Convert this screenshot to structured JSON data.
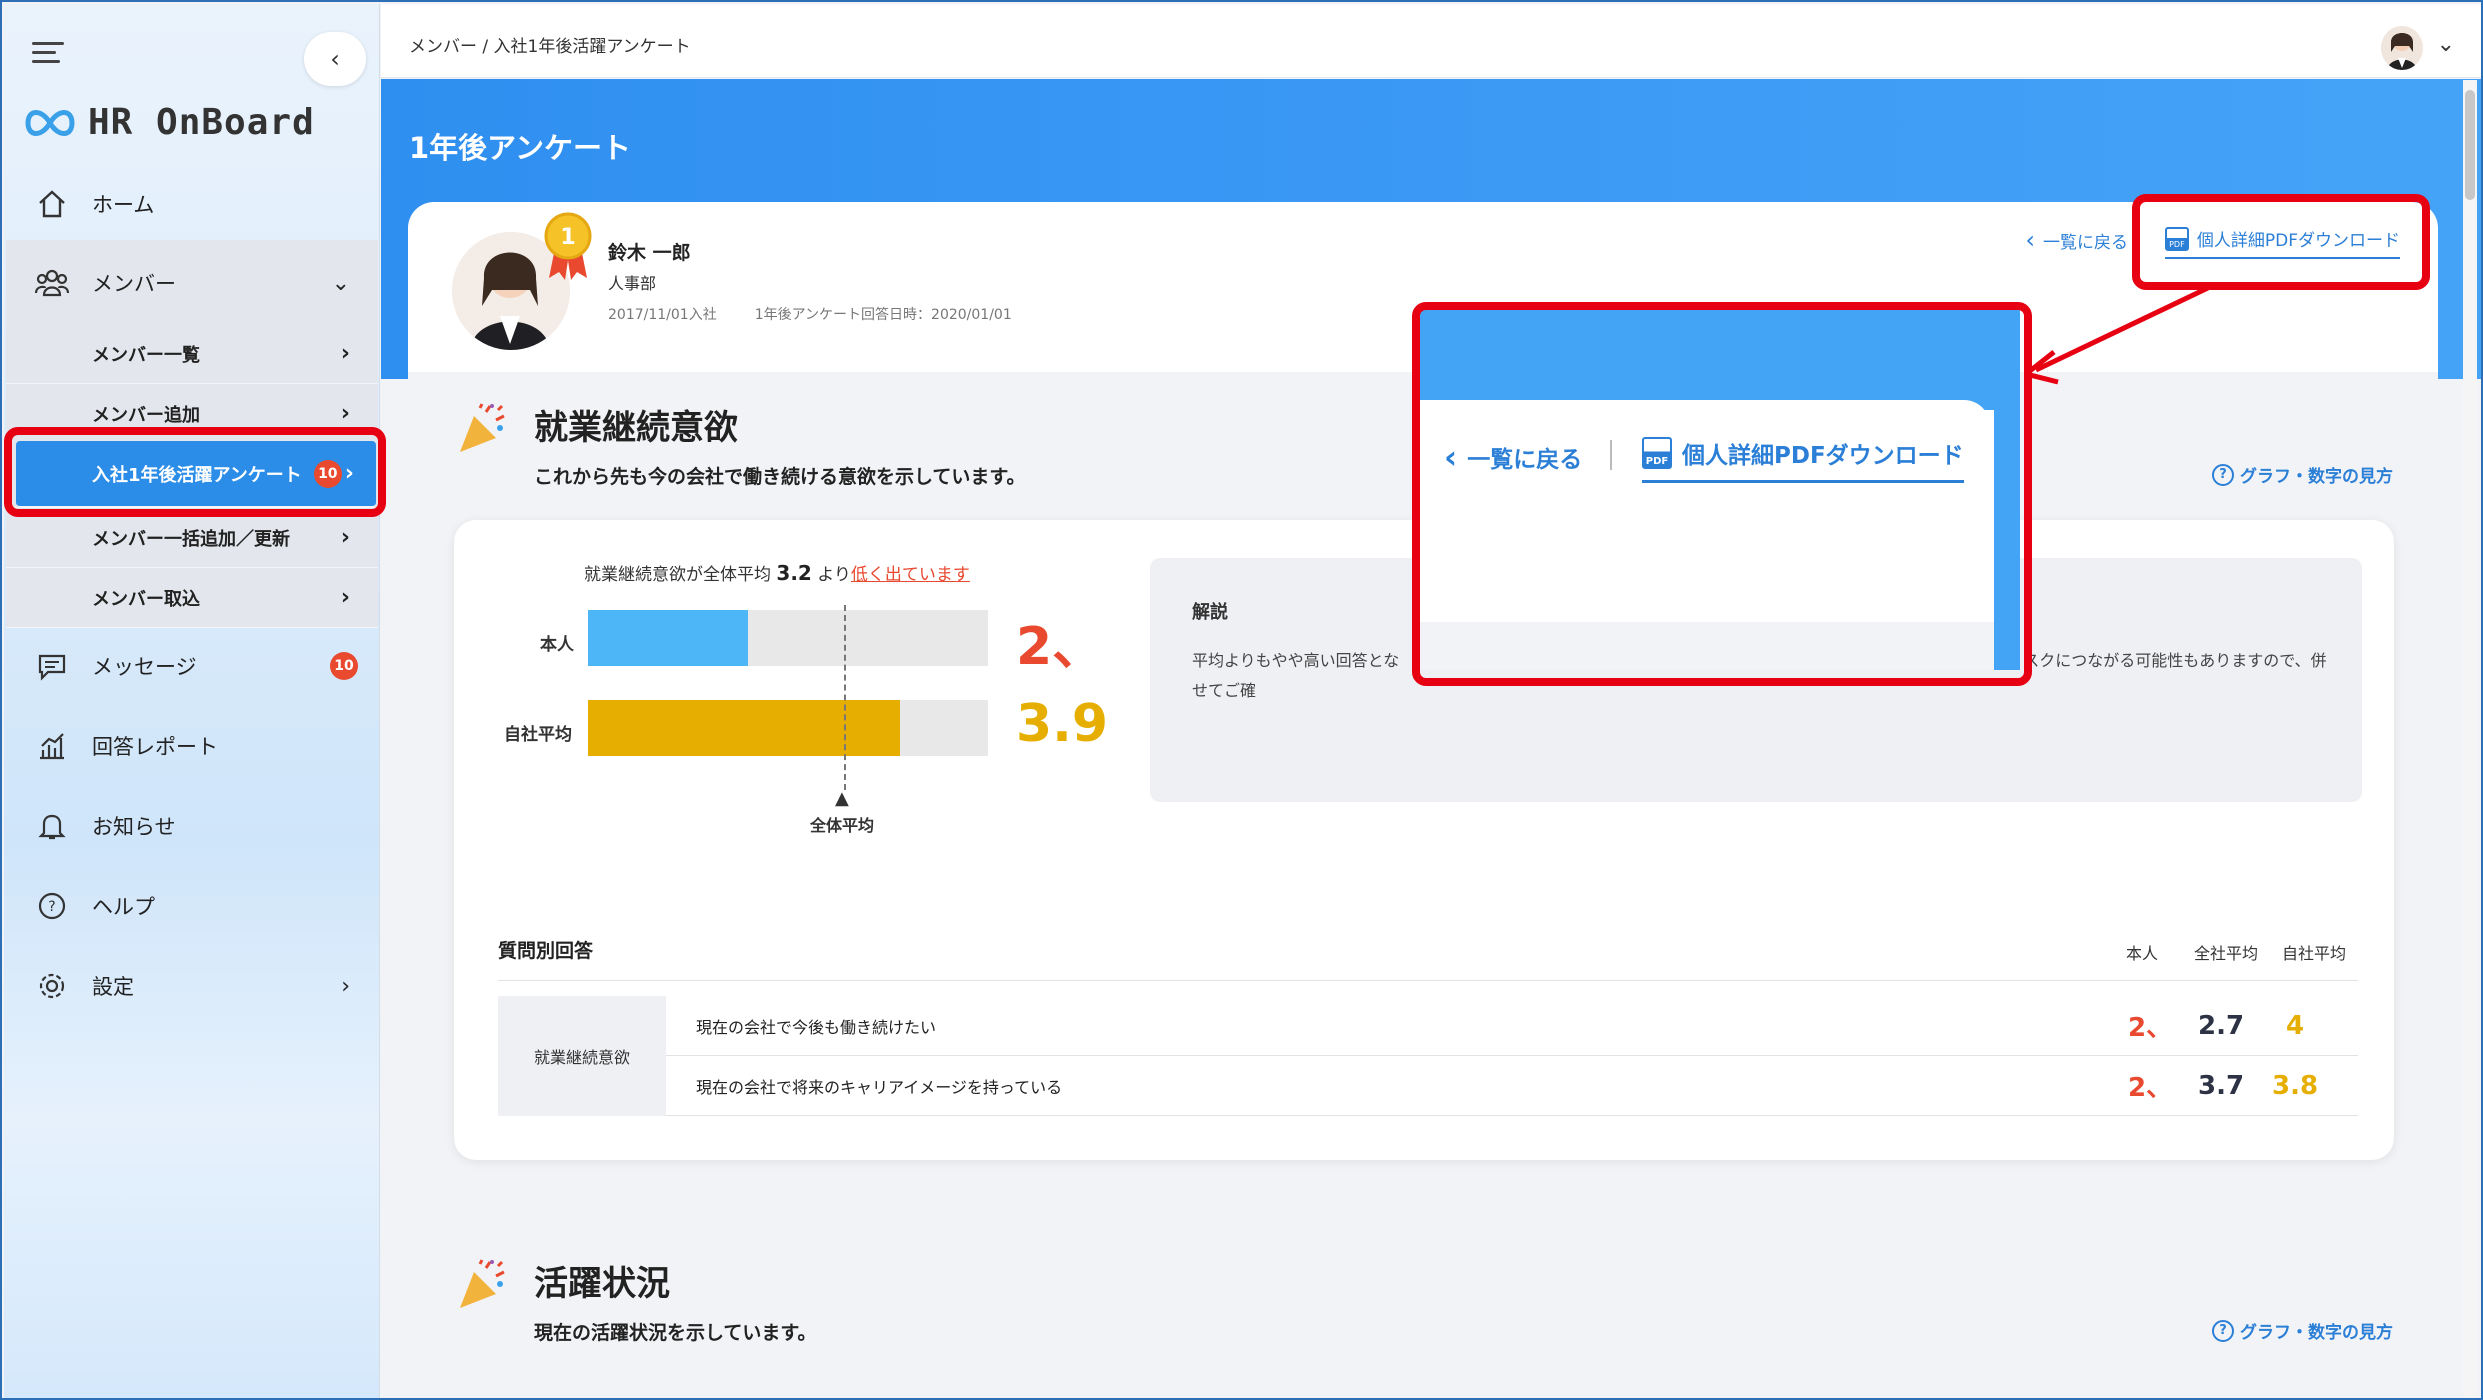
{
  "sidebar": {
    "logo": "HR OnBoard",
    "items": [
      {
        "label": "ホーム"
      },
      {
        "label": "メンバー"
      },
      {
        "label": "メッセージ",
        "badge": "10"
      },
      {
        "label": "回答レポート"
      },
      {
        "label": "お知らせ"
      },
      {
        "label": "ヘルプ"
      },
      {
        "label": "設定"
      }
    ],
    "subitems": [
      {
        "label": "メンバー一覧"
      },
      {
        "label": "メンバー追加"
      },
      {
        "label": "入社1年後活躍アンケート",
        "badge": "10"
      },
      {
        "label": "メンバー一括追加／更新"
      },
      {
        "label": "メンバー取込"
      }
    ]
  },
  "topbar": {
    "breadcrumb": "メンバー / 入社1年後活躍アンケート"
  },
  "hero": {
    "title": "1年後アンケート"
  },
  "profile": {
    "medal_rank": "1",
    "name": "鈴木 一郎",
    "dept": "人事部",
    "joined": "2017/11/01入社",
    "answered": "1年後アンケート回答日時：2020/01/01",
    "back_label": "一覧に戻る",
    "pdf_label": "個人詳細PDFダウンロード"
  },
  "section1": {
    "title": "就業継続意欲",
    "desc": "これから先も今の会社で働き続ける意欲を示しています。",
    "help": "グラフ・数字の見方",
    "compare_prefix": "就業継続意欲が全体平均",
    "compare_value": "3.2",
    "compare_mid": "より",
    "compare_result": "低く出ています",
    "rows": [
      {
        "label": "本人",
        "value": 2,
        "score_text": "2、",
        "color": "#4db6f7",
        "score_color": "#e8492f"
      },
      {
        "label": "自社平均",
        "value": 3.9,
        "score_text": "3.9",
        "color": "#e6ae00",
        "score_color": "#e6ae00"
      }
    ],
    "bar_max": 5,
    "avg_label": "全体平均",
    "avg_value": 3.2,
    "explain_title": "解説",
    "explain_text": "平均よりもやや高い回答とな　　　　　　　　　　　　　　　　　　　　　　　　　　　　　　　　　　来の離職リスクにつながる可能性もありますので、併せてご確",
    "questions_title": "質問別回答",
    "col_self": "本人",
    "col_all": "全社平均",
    "col_own": "自社平均",
    "category": "就業継続意欲",
    "questions": [
      {
        "text": "現在の会社で今後も働き続けたい",
        "self": "2、",
        "all": "2.7",
        "own": "4"
      },
      {
        "text": "現在の会社で将来のキャリアイメージを持っている",
        "self": "2、",
        "all": "3.7",
        "own": "3.8"
      }
    ]
  },
  "section2": {
    "title": "活躍状況",
    "desc": "現在の活躍状況を示しています。",
    "help": "グラフ・数字の見方"
  },
  "zoom": {
    "back_label": "一覧に戻る",
    "pdf_label": "個人詳細PDFダウンロード"
  }
}
